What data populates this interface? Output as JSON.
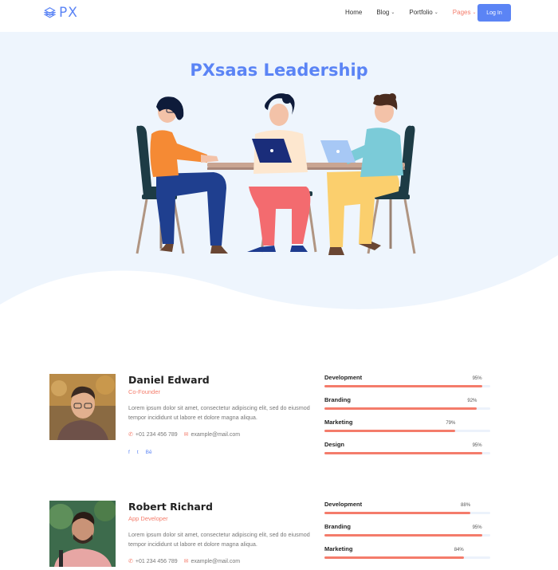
{
  "brand": {
    "logo_text": "PX",
    "color": "#5b84f5",
    "accent": "#f47c6b"
  },
  "nav": {
    "items": [
      {
        "label": "Home",
        "dropdown": false,
        "active": false
      },
      {
        "label": "Blog",
        "dropdown": true,
        "active": false
      },
      {
        "label": "Portfolio",
        "dropdown": true,
        "active": false
      },
      {
        "label": "Pages",
        "dropdown": true,
        "active": true
      }
    ],
    "login_label": "Log In"
  },
  "hero": {
    "title": "PXsaas Leadership"
  },
  "team": [
    {
      "name": "Daniel Edward",
      "role": "Co-Founder",
      "bio": "Lorem ipsum dolor sit amet, consectetur adipiscing elit, sed do eiusmod tempor incididunt ut labore et dolore magna aliqua.",
      "phone": "+01 234 456 789",
      "email": "example@mail.com",
      "socials": [
        "f",
        "t",
        "Bē"
      ],
      "skills": [
        {
          "label": "Development",
          "value": 95,
          "display": "95%"
        },
        {
          "label": "Branding",
          "value": 92,
          "display": "92%"
        },
        {
          "label": "Marketing",
          "value": 79,
          "display": "79%"
        },
        {
          "label": "Design",
          "value": 95,
          "display": "95%"
        }
      ]
    },
    {
      "name": "Robert Richard",
      "role": "App Developer",
      "bio": "Lorem ipsum dolor sit amet, consectetur adipiscing elit, sed do eiusmod tempor incididunt ut labore et dolore magna aliqua.",
      "phone": "+01 234 456 789",
      "email": "example@mail.com",
      "socials": [],
      "skills": [
        {
          "label": "Development",
          "value": 88,
          "display": "88%"
        },
        {
          "label": "Branding",
          "value": 95,
          "display": "95%"
        },
        {
          "label": "Marketing",
          "value": 84,
          "display": "84%"
        }
      ]
    }
  ]
}
